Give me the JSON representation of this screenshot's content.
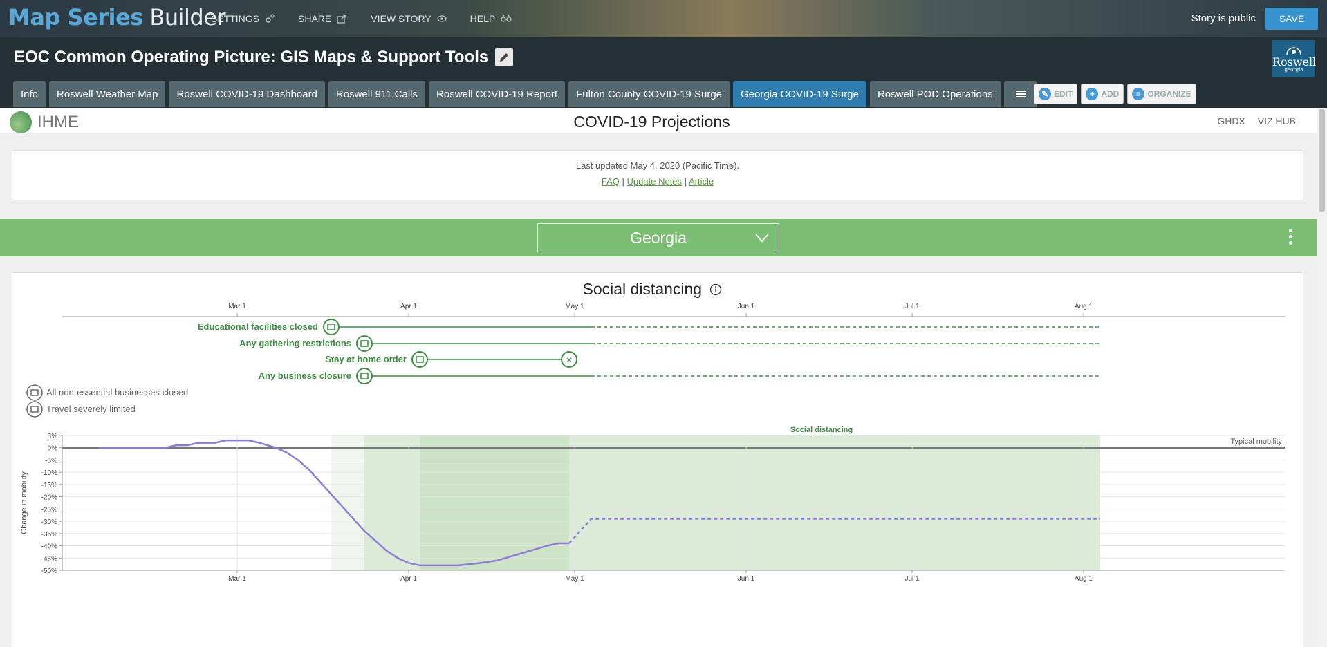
{
  "builder": {
    "brand_primary": "Map Series",
    "brand_secondary": "Builder",
    "nav": [
      {
        "label": "SETTINGS",
        "icon": "gear-icon"
      },
      {
        "label": "SHARE",
        "icon": "share-icon"
      },
      {
        "label": "VIEW STORY",
        "icon": "eye-icon"
      },
      {
        "label": "HELP",
        "icon": "help-icon"
      }
    ],
    "public_status": "Story is public",
    "save_label": "SAVE"
  },
  "story": {
    "title": "EOC Common Operating Picture: GIS Maps & Support Tools",
    "logo_text": "Roswell",
    "logo_subtext": "georgia",
    "tabs": [
      {
        "label": "Info",
        "active": false
      },
      {
        "label": "Roswell Weather Map",
        "active": false
      },
      {
        "label": "Roswell COVID-19 Dashboard",
        "active": false
      },
      {
        "label": "Roswell 911 Calls",
        "active": false
      },
      {
        "label": "Roswell COVID-19 Report",
        "active": false
      },
      {
        "label": "Fulton County COVID-19 Surge",
        "active": false
      },
      {
        "label": "Georgia COVID-19 Surge",
        "active": true
      },
      {
        "label": "Roswell POD Operations",
        "active": false
      }
    ],
    "tools": [
      {
        "label": "EDIT",
        "icon": "pencil-icon"
      },
      {
        "label": "ADD",
        "icon": "plus-icon"
      },
      {
        "label": "ORGANIZE",
        "icon": "list-icon"
      }
    ]
  },
  "ihme": {
    "logo_text": "IHME",
    "page_title": "COVID-19 Projections",
    "links": [
      "GHDX",
      "VIZ HUB"
    ],
    "updated_text": "Last updated May 4, 2020 (Pacific Time).",
    "doc_links": [
      "FAQ",
      "Update Notes",
      "Article"
    ],
    "separator": "|",
    "location": "Georgia",
    "section_title": "Social distancing"
  },
  "colors": {
    "accent_blue": "#3693cf",
    "ihme_green": "#7abf73",
    "policy_green": "#3f8f45",
    "mobility_line": "#8f7ad6"
  },
  "chart_data": {
    "type": "line",
    "title": "Social distancing",
    "x_ticks": [
      "Mar 1",
      "Apr 1",
      "May 1",
      "Jun 1",
      "Jul 1",
      "Aug 1"
    ],
    "policies": [
      {
        "label": "Educational facilities closed",
        "icon": "school-icon",
        "start": "2020-03-18",
        "observed_until": "2020-05-04",
        "projected_until": "2020-08-04"
      },
      {
        "label": "Any gathering restrictions",
        "icon": "gathering-icon",
        "start": "2020-03-24",
        "observed_until": "2020-05-04",
        "projected_until": "2020-08-04"
      },
      {
        "label": "Stay at home order",
        "icon": "home-icon",
        "start": "2020-04-03",
        "end": "2020-04-30"
      },
      {
        "label": "Any business closure",
        "icon": "fork-icon",
        "start": "2020-03-24",
        "observed_until": "2020-05-04",
        "projected_until": "2020-08-04"
      }
    ],
    "legend": [
      {
        "label": "All non-essential businesses closed",
        "icon": "store-icon"
      },
      {
        "label": "Travel severely limited",
        "icon": "travel-icon"
      }
    ],
    "ylabel": "Change in mobility",
    "y_ticks": [
      "5%",
      "0%",
      "-5%",
      "-10%",
      "-15%",
      "-20%",
      "-25%",
      "-30%",
      "-35%",
      "-40%",
      "-45%",
      "-50%"
    ],
    "ylim": [
      -50,
      5
    ],
    "band_label": "Social distancing",
    "reference_label": "Typical mobility",
    "series": [
      {
        "observed": [
          [
            "2020-02-05",
            0
          ],
          [
            "2020-02-17",
            0
          ],
          [
            "2020-02-19",
            1
          ],
          [
            "2020-02-21",
            1
          ],
          [
            "2020-02-23",
            2
          ],
          [
            "2020-02-26",
            2
          ],
          [
            "2020-02-28",
            3
          ],
          [
            "2020-03-03",
            3
          ],
          [
            "2020-03-05",
            2
          ],
          [
            "2020-03-08",
            0
          ],
          [
            "2020-03-10",
            -2
          ],
          [
            "2020-03-12",
            -5
          ],
          [
            "2020-03-14",
            -9
          ],
          [
            "2020-03-16",
            -14
          ],
          [
            "2020-03-18",
            -19
          ],
          [
            "2020-03-20",
            -24
          ],
          [
            "2020-03-22",
            -29
          ],
          [
            "2020-03-24",
            -34
          ],
          [
            "2020-03-26",
            -38
          ],
          [
            "2020-03-28",
            -42
          ],
          [
            "2020-03-30",
            -45
          ],
          [
            "2020-04-01",
            -47
          ],
          [
            "2020-04-03",
            -48
          ],
          [
            "2020-04-05",
            -48
          ],
          [
            "2020-04-10",
            -48
          ],
          [
            "2020-04-14",
            -47
          ],
          [
            "2020-04-17",
            -46
          ],
          [
            "2020-04-20",
            -44
          ],
          [
            "2020-04-23",
            -42
          ],
          [
            "2020-04-26",
            -40
          ],
          [
            "2020-04-28",
            -39
          ],
          [
            "2020-04-30",
            -39
          ]
        ],
        "projected": [
          [
            "2020-04-30",
            -39
          ],
          [
            "2020-05-04",
            -29
          ],
          [
            "2020-08-04",
            -29
          ]
        ]
      }
    ],
    "shaded_periods": [
      {
        "start": "2020-03-18",
        "end": "2020-08-04",
        "shade": "light"
      },
      {
        "start": "2020-03-24",
        "end": "2020-08-04",
        "shade": "medium"
      },
      {
        "start": "2020-04-03",
        "end": "2020-04-30",
        "shade": "dark"
      }
    ]
  }
}
